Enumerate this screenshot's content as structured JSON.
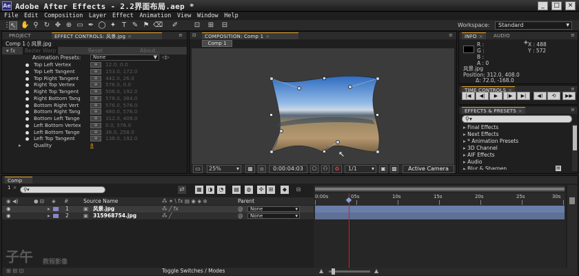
{
  "window": {
    "title": "Adobe After Effects - 2.2界面布局.aep *",
    "controls": [
      "_",
      "□",
      "×"
    ]
  },
  "menu": [
    "File",
    "Edit",
    "Composition",
    "Layer",
    "Effect",
    "Animation",
    "View",
    "Window",
    "Help"
  ],
  "workspace": {
    "label": "Workspace:",
    "value": "Standard"
  },
  "left_panel": {
    "tabs": [
      "PROJECT",
      "EFFECT CONTROLS: 风景.jpg"
    ],
    "breadcrumb": "Comp 1 ◊ 风景.jpg",
    "effect_name": "Bezier Warp",
    "reset": "Reset",
    "about": "About...",
    "presets_label": "Animation Presets:",
    "presets_value": "None",
    "properties": [
      {
        "label": "Top Left Vertex",
        "value": "12.0, 0.0"
      },
      {
        "label": "Top Left Tangent",
        "value": "153.0, 172.0"
      },
      {
        "label": "Top Right Tangent",
        "value": "442.0, 26.0"
      },
      {
        "label": "Right Top Vertex",
        "value": "576.0, 0.0"
      },
      {
        "label": "Right Top Tangent",
        "value": "506.0, 192.0"
      },
      {
        "label": "Right Bottom Tang",
        "value": "578.0, 384.0"
      },
      {
        "label": "Bottom Right Vert",
        "value": "576.0, 576.0"
      },
      {
        "label": "Bottom Right Tang",
        "value": "480.0, 576.0"
      },
      {
        "label": "Bottom Left Tange",
        "value": "312.0, 408.0"
      },
      {
        "label": "Left Bottom Vertex",
        "value": "0.0, 576.0"
      },
      {
        "label": "Left Bottom Tange",
        "value": "36.0, 258.0"
      },
      {
        "label": "Left Top Tangent",
        "value": "138.0, 192.0"
      }
    ],
    "quality_label": "Quality",
    "quality_value": "8"
  },
  "comp_panel": {
    "tab": "COMPOSITION: Comp 1",
    "comp_tab": "Comp 1",
    "zoom": "25%",
    "timecode": "0:00:04:03",
    "resolution": "1/1",
    "camera": "Active Camera"
  },
  "info": {
    "tabs": [
      "INFO",
      "AUDIO"
    ],
    "r": "R :",
    "g": "G :",
    "b": "B :",
    "a": "A : 0",
    "x": "X : 488",
    "y": "Y : 572",
    "file": "风景.jpg",
    "position": "Position: 312.0, 408.0",
    "delta": "Δ: 72.0, -168.0"
  },
  "time_controls": {
    "tab": "TIME CONTROLS"
  },
  "effects_presets": {
    "tab": "EFFECTS & PRESETS",
    "items": [
      "Final Effects",
      "Next Effects",
      "* Animation Presets",
      "3D Channel",
      "AIF Effects",
      "Audio",
      "Blur & Sharpen"
    ]
  },
  "timeline": {
    "tab": "Comp 1",
    "search_placeholder": "",
    "col_source": "Source Name",
    "col_parent": "Parent",
    "ticks": [
      "0:00s",
      "05s",
      "10s",
      "15s",
      "20s",
      "25s",
      "30s"
    ],
    "layers": [
      {
        "num": "1",
        "name": "风景.jpg",
        "parent": "None"
      },
      {
        "num": "2",
        "name": "315968754.jpg",
        "parent": "None"
      }
    ],
    "bottom_label": "Toggle Switches / Modes",
    "current_time": "0:00:04:03",
    "playhead_seconds": 4.1,
    "duration_seconds": 30
  },
  "watermark": {
    "brand": "子午",
    "sub": "教程影像"
  },
  "colors": {
    "accent": "#e0a020",
    "playhead": "#d02020",
    "layer_label": "#8a86c8",
    "timebar": "#6a7eaa"
  }
}
